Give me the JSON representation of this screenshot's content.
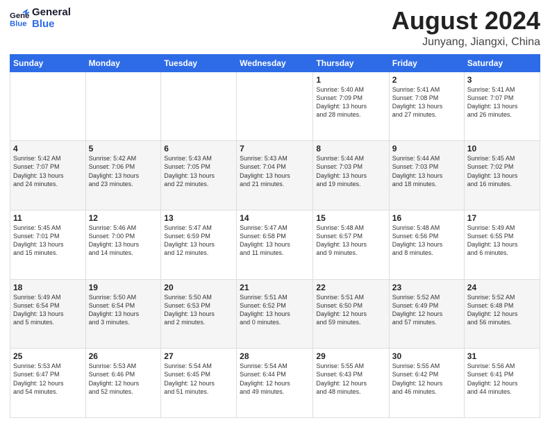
{
  "logo": {
    "line1": "General",
    "line2": "Blue"
  },
  "title": "August 2024",
  "subtitle": "Junyang, Jiangxi, China",
  "weekdays": [
    "Sunday",
    "Monday",
    "Tuesday",
    "Wednesday",
    "Thursday",
    "Friday",
    "Saturday"
  ],
  "weeks": [
    [
      {
        "day": "",
        "info": ""
      },
      {
        "day": "",
        "info": ""
      },
      {
        "day": "",
        "info": ""
      },
      {
        "day": "",
        "info": ""
      },
      {
        "day": "1",
        "info": "Sunrise: 5:40 AM\nSunset: 7:09 PM\nDaylight: 13 hours\nand 28 minutes."
      },
      {
        "day": "2",
        "info": "Sunrise: 5:41 AM\nSunset: 7:08 PM\nDaylight: 13 hours\nand 27 minutes."
      },
      {
        "day": "3",
        "info": "Sunrise: 5:41 AM\nSunset: 7:07 PM\nDaylight: 13 hours\nand 26 minutes."
      }
    ],
    [
      {
        "day": "4",
        "info": "Sunrise: 5:42 AM\nSunset: 7:07 PM\nDaylight: 13 hours\nand 24 minutes."
      },
      {
        "day": "5",
        "info": "Sunrise: 5:42 AM\nSunset: 7:06 PM\nDaylight: 13 hours\nand 23 minutes."
      },
      {
        "day": "6",
        "info": "Sunrise: 5:43 AM\nSunset: 7:05 PM\nDaylight: 13 hours\nand 22 minutes."
      },
      {
        "day": "7",
        "info": "Sunrise: 5:43 AM\nSunset: 7:04 PM\nDaylight: 13 hours\nand 21 minutes."
      },
      {
        "day": "8",
        "info": "Sunrise: 5:44 AM\nSunset: 7:03 PM\nDaylight: 13 hours\nand 19 minutes."
      },
      {
        "day": "9",
        "info": "Sunrise: 5:44 AM\nSunset: 7:03 PM\nDaylight: 13 hours\nand 18 minutes."
      },
      {
        "day": "10",
        "info": "Sunrise: 5:45 AM\nSunset: 7:02 PM\nDaylight: 13 hours\nand 16 minutes."
      }
    ],
    [
      {
        "day": "11",
        "info": "Sunrise: 5:45 AM\nSunset: 7:01 PM\nDaylight: 13 hours\nand 15 minutes."
      },
      {
        "day": "12",
        "info": "Sunrise: 5:46 AM\nSunset: 7:00 PM\nDaylight: 13 hours\nand 14 minutes."
      },
      {
        "day": "13",
        "info": "Sunrise: 5:47 AM\nSunset: 6:59 PM\nDaylight: 13 hours\nand 12 minutes."
      },
      {
        "day": "14",
        "info": "Sunrise: 5:47 AM\nSunset: 6:58 PM\nDaylight: 13 hours\nand 11 minutes."
      },
      {
        "day": "15",
        "info": "Sunrise: 5:48 AM\nSunset: 6:57 PM\nDaylight: 13 hours\nand 9 minutes."
      },
      {
        "day": "16",
        "info": "Sunrise: 5:48 AM\nSunset: 6:56 PM\nDaylight: 13 hours\nand 8 minutes."
      },
      {
        "day": "17",
        "info": "Sunrise: 5:49 AM\nSunset: 6:55 PM\nDaylight: 13 hours\nand 6 minutes."
      }
    ],
    [
      {
        "day": "18",
        "info": "Sunrise: 5:49 AM\nSunset: 6:54 PM\nDaylight: 13 hours\nand 5 minutes."
      },
      {
        "day": "19",
        "info": "Sunrise: 5:50 AM\nSunset: 6:54 PM\nDaylight: 13 hours\nand 3 minutes."
      },
      {
        "day": "20",
        "info": "Sunrise: 5:50 AM\nSunset: 6:53 PM\nDaylight: 13 hours\nand 2 minutes."
      },
      {
        "day": "21",
        "info": "Sunrise: 5:51 AM\nSunset: 6:52 PM\nDaylight: 13 hours\nand 0 minutes."
      },
      {
        "day": "22",
        "info": "Sunrise: 5:51 AM\nSunset: 6:50 PM\nDaylight: 12 hours\nand 59 minutes."
      },
      {
        "day": "23",
        "info": "Sunrise: 5:52 AM\nSunset: 6:49 PM\nDaylight: 12 hours\nand 57 minutes."
      },
      {
        "day": "24",
        "info": "Sunrise: 5:52 AM\nSunset: 6:48 PM\nDaylight: 12 hours\nand 56 minutes."
      }
    ],
    [
      {
        "day": "25",
        "info": "Sunrise: 5:53 AM\nSunset: 6:47 PM\nDaylight: 12 hours\nand 54 minutes."
      },
      {
        "day": "26",
        "info": "Sunrise: 5:53 AM\nSunset: 6:46 PM\nDaylight: 12 hours\nand 52 minutes."
      },
      {
        "day": "27",
        "info": "Sunrise: 5:54 AM\nSunset: 6:45 PM\nDaylight: 12 hours\nand 51 minutes."
      },
      {
        "day": "28",
        "info": "Sunrise: 5:54 AM\nSunset: 6:44 PM\nDaylight: 12 hours\nand 49 minutes."
      },
      {
        "day": "29",
        "info": "Sunrise: 5:55 AM\nSunset: 6:43 PM\nDaylight: 12 hours\nand 48 minutes."
      },
      {
        "day": "30",
        "info": "Sunrise: 5:55 AM\nSunset: 6:42 PM\nDaylight: 12 hours\nand 46 minutes."
      },
      {
        "day": "31",
        "info": "Sunrise: 5:56 AM\nSunset: 6:41 PM\nDaylight: 12 hours\nand 44 minutes."
      }
    ]
  ]
}
